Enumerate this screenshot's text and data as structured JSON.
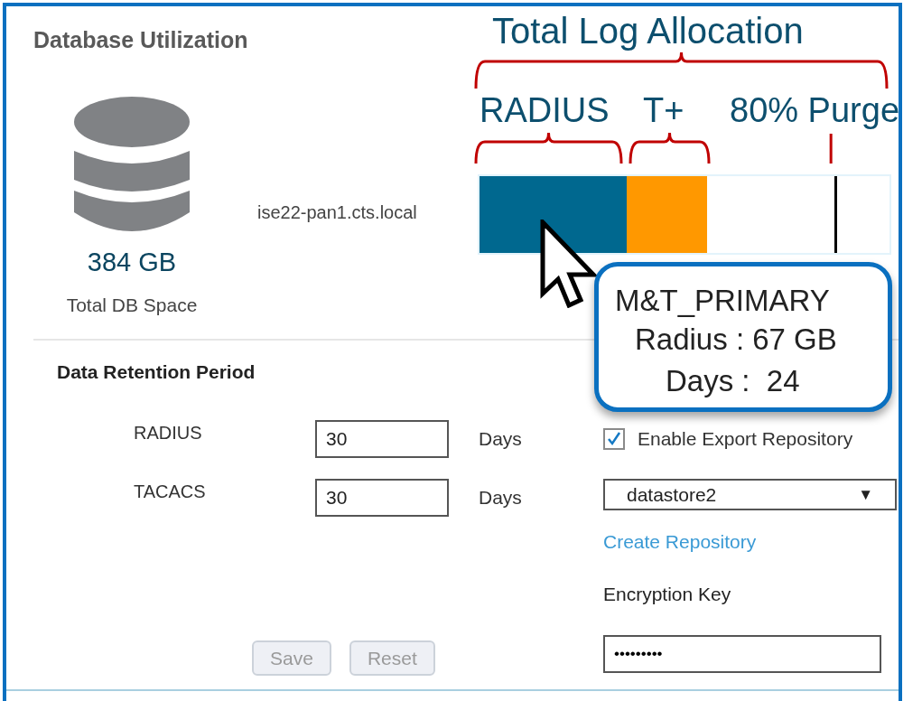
{
  "annotations": {
    "title": "Total Log Allocation",
    "labels": [
      {
        "text": "RADIUS",
        "kind": "bracket"
      },
      {
        "text": "T+",
        "kind": "bracket"
      },
      {
        "text": "80% Purge",
        "kind": "tick"
      }
    ]
  },
  "panel": {
    "title": "Database Utilization",
    "total_db": {
      "size": "384 GB",
      "label": "Total DB Space"
    },
    "node": {
      "host": "ise22-pan1.cts.local",
      "segments": [
        {
          "color": "#00688f"
        },
        {
          "color": "#ff9800"
        }
      ],
      "purge_marker": {
        "level": 0.866
      }
    },
    "retention": {
      "title": "Data Retention Period",
      "rows": [
        {
          "label": "RADIUS",
          "value": "30",
          "unit": "Days"
        },
        {
          "label": "TACACS",
          "value": "30",
          "unit": "Days"
        }
      ]
    },
    "buttons": [
      {
        "label": "Save",
        "disabled": true
      },
      {
        "label": "Reset",
        "disabled": true
      }
    ],
    "export": {
      "checkbox": {
        "label": "Enable Export Repository",
        "checked": true
      },
      "repository": {
        "value": "datastore2",
        "arrow": "▼"
      },
      "link": "Create Repository",
      "key_label": "Encryption Key",
      "key_value": "•••••••••"
    }
  },
  "tooltip": {
    "title": "M&T_PRIMARY",
    "lines": [
      "Radius : 67 GB",
      "Days :  24"
    ]
  }
}
